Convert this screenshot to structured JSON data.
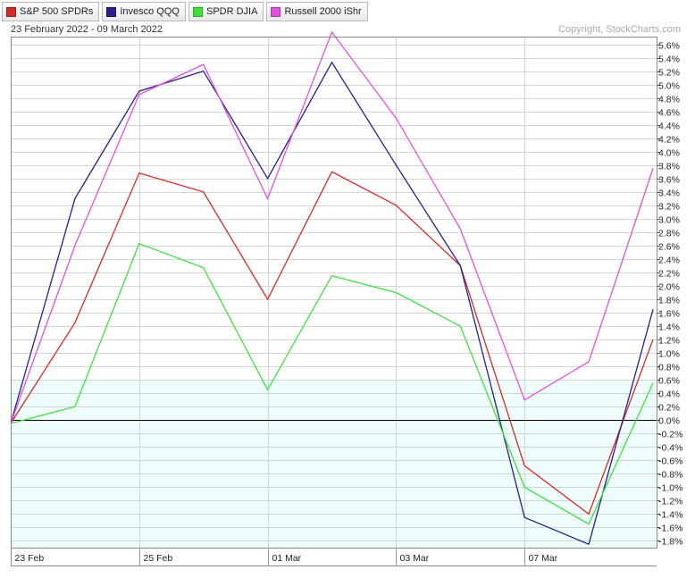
{
  "legend": {
    "items": [
      {
        "label": "S&P 500 SPDRs",
        "color": "#d42a2a"
      },
      {
        "label": "Invesco QQQ",
        "color": "#2a1e8c"
      },
      {
        "label": "SPDR DJIA",
        "color": "#3ee03e"
      },
      {
        "label": "Russell 2000 iShr",
        "color": "#e050e0"
      }
    ]
  },
  "header": {
    "date_range": "23 February 2022 - 09 March 2022",
    "copyright": "Copyright, StockCharts.com"
  },
  "chart_data": {
    "type": "line",
    "x": [
      "23 Feb",
      "24 Feb",
      "25 Feb",
      "28 Feb",
      "01 Mar",
      "02 Mar",
      "03 Mar",
      "04 Mar",
      "07 Mar",
      "08 Mar",
      "09 Mar"
    ],
    "x_tick_labels": [
      "23 Feb",
      "25 Feb",
      "01 Mar",
      "03 Mar",
      "07 Mar"
    ],
    "ylim": [
      -1.9,
      5.7
    ],
    "y_ticks": [
      -1.8,
      -1.6,
      -1.4,
      -1.2,
      -1.0,
      -0.8,
      -0.6,
      -0.4,
      -0.2,
      0.0,
      0.2,
      0.4,
      0.6,
      0.8,
      1.0,
      1.2,
      1.4,
      1.6,
      1.8,
      2.0,
      2.2,
      2.4,
      2.6,
      2.8,
      3.0,
      3.2,
      3.4,
      3.6,
      3.8,
      4.0,
      4.2,
      4.4,
      4.6,
      4.8,
      5.0,
      5.2,
      5.4,
      5.6
    ],
    "y_tick_labels": [
      "-1.8%",
      "-1.6%",
      "-1.4%",
      "-1.2%",
      "-1.0%",
      "-0.8%",
      "-0.6%",
      "-0.4%",
      "-0.2%",
      "0.0%",
      "0.2%",
      "0.4%",
      "0.6%",
      "0.8%",
      "1.0%",
      "1.2%",
      "1.4%",
      "1.6%",
      "1.8%",
      "2.0%",
      "2.2%",
      "2.4%",
      "2.6%",
      "2.8%",
      "3.0%",
      "3.2%",
      "3.4%",
      "3.6%",
      "3.8%",
      "4.0%",
      "4.2%",
      "4.4%",
      "4.6%",
      "4.8%",
      "5.0%",
      "5.2%",
      "5.4%",
      "5.6%"
    ],
    "grid": true,
    "legend_position": "top-left",
    "y_axis_side": "right",
    "series": [
      {
        "name": "S&P 500 SPDRs",
        "color": "#d42a2a",
        "values": [
          -0.05,
          1.45,
          3.68,
          3.4,
          1.8,
          3.7,
          3.2,
          2.3,
          -0.68,
          -1.4,
          1.2
        ]
      },
      {
        "name": "Invesco QQQ",
        "color": "#2a1e8c",
        "values": [
          -0.05,
          3.3,
          4.9,
          5.2,
          3.6,
          5.33,
          3.8,
          2.3,
          -1.45,
          -1.85,
          1.65
        ]
      },
      {
        "name": "SPDR DJIA",
        "color": "#3ee03e",
        "values": [
          -0.05,
          0.2,
          2.63,
          2.27,
          0.45,
          2.15,
          1.9,
          1.4,
          -1.0,
          -1.55,
          0.55
        ]
      },
      {
        "name": "Russell 2000 iShr",
        "color": "#e050e0",
        "values": [
          -0.05,
          2.6,
          4.85,
          5.3,
          3.3,
          5.78,
          4.5,
          2.85,
          0.3,
          0.87,
          3.75
        ]
      }
    ]
  }
}
